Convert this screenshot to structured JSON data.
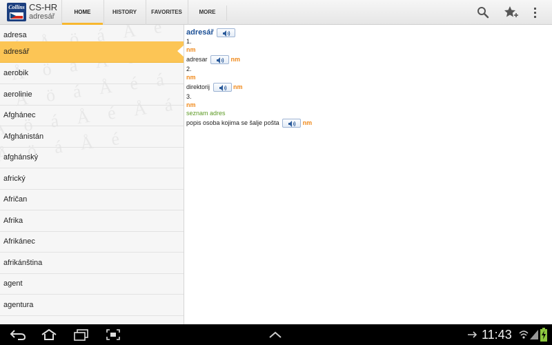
{
  "app": {
    "logo_text": "Collins",
    "title": "CS-HR",
    "subtitle": "adresář"
  },
  "tabs": [
    {
      "label": "HOME",
      "active": true
    },
    {
      "label": "HISTORY",
      "active": false
    },
    {
      "label": "FAVORITES",
      "active": false
    },
    {
      "label": "MORE",
      "active": false
    }
  ],
  "actions": {
    "search_icon": "search-icon",
    "add_favorite_icon": "star-plus-icon",
    "overflow_icon": "overflow-menu-icon"
  },
  "wordlist": {
    "items": [
      "adresa",
      "adresář",
      "aerobik",
      "aerolinie",
      "Afghánec",
      "Afghánistán",
      "afghánský",
      "africký",
      "Afričan",
      "Afrika",
      "Afrikánec",
      "afrikánština",
      "agent",
      "agentura"
    ],
    "selected_index": 1
  },
  "entry": {
    "headword": "adresář",
    "senses": [
      {
        "number": "1.",
        "pos": "nm",
        "translation": "adresar",
        "translation_pos": "nm"
      },
      {
        "number": "2.",
        "pos": "nm",
        "translation": "direktorij",
        "translation_pos": "nm"
      },
      {
        "number": "3.",
        "pos": "nm",
        "gloss": "seznam adres",
        "translation": "popis osoba kojima se šalje pošta",
        "translation_pos": "nm"
      }
    ]
  },
  "system_bar": {
    "time": "11:43"
  },
  "colors": {
    "selection": "#fcc555",
    "headword": "#1b4f95",
    "pos": "#f08a1c",
    "gloss": "#5c9a24",
    "tab_indicator": "#f7b72f"
  }
}
